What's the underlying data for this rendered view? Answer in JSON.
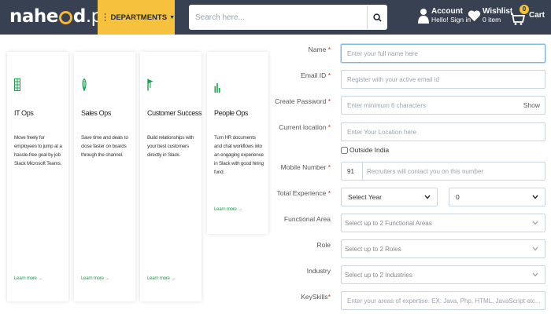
{
  "header": {
    "logo": {
      "pre": "nahe",
      "post": "d",
      "tld": ".pk"
    },
    "departments_label": "DEPARTMENTS",
    "search_placeholder": "Search here...",
    "account": {
      "title": "Account",
      "subtitle": "Hello! Sign in"
    },
    "wishlist": {
      "title": "Wishlist",
      "subtitle": "0 item"
    },
    "cart": {
      "count": "0",
      "label": "Cart"
    },
    "colors": {
      "bar": "#374151",
      "accent": "#f6c13d"
    }
  },
  "cards": [
    {
      "icon": "grid-icon",
      "title": "IT Ops",
      "description": "Move freely for employees to jump at a hassle-free goal by job Slack Microsoft Teams.",
      "link": "Learn more →"
    },
    {
      "icon": "leaf-icon",
      "title": "Sales Ops",
      "description": "Save time and deals to close faster on boards through the channel.",
      "link": "Learn more →"
    },
    {
      "icon": "flag-icon",
      "title": "Customer Success",
      "description": "Build relationships with your best customers directly in Slack.",
      "link": "Learn more →"
    },
    {
      "icon": "bars-icon",
      "title": "People Ops",
      "description": "Turn HR documents and chat workflows into an engaging experience in Slack with good hiring fund.",
      "link": "Learn more →"
    }
  ],
  "form": {
    "name": {
      "label": "Name",
      "placeholder": "Enter your full name here"
    },
    "email": {
      "label": "Email ID",
      "placeholder": "Register with your active email id"
    },
    "password": {
      "label": "Create Password",
      "placeholder": "Enter minimum 6 characters",
      "toggle": "Show"
    },
    "location": {
      "label": "Current location",
      "placeholder": "Enter Your Location here"
    },
    "outside_india": "Outside India",
    "mobile": {
      "label": "Mobile Number",
      "code": "91",
      "placeholder": "Recruiters will contact you on this number"
    },
    "experience": {
      "label": "Total Experience",
      "year": "Select Year",
      "month": "0"
    },
    "functional_area": {
      "label": "Functional Area",
      "placeholder": "Select up to 2 Functional Areas"
    },
    "role": {
      "label": "Role",
      "placeholder": "Select up to 2 Roles"
    },
    "industry": {
      "label": "Industry",
      "placeholder": "Select up to 2 Industries"
    },
    "keyskills": {
      "label": "KeySkills",
      "placeholder": "Enter your areas of expertise. EX: Java, Php, HTML, JavaScript etc..."
    },
    "required_mark": "*"
  }
}
